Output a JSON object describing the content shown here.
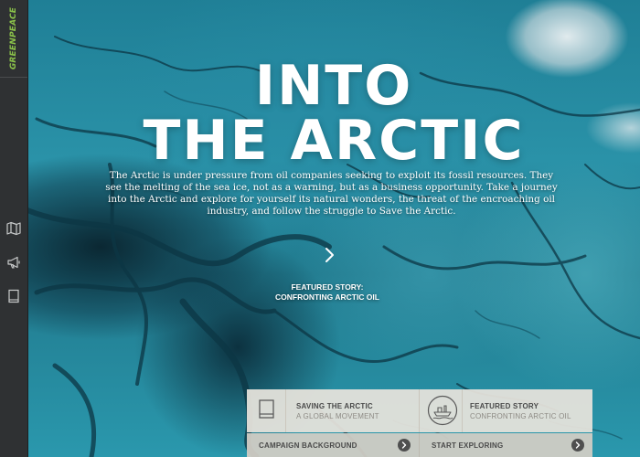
{
  "brand": {
    "logo_text": "GREENPEACE",
    "logo_color": "#8bc34a"
  },
  "sidebar": {
    "items": [
      {
        "icon": "map-icon"
      },
      {
        "icon": "megaphone-icon"
      },
      {
        "icon": "book-icon"
      }
    ]
  },
  "hero": {
    "title_line1": "INTO",
    "title_line2": "THE ARCTIC",
    "intro": "The Arctic is under pressure from oil companies seeking to exploit its fossil resources. They see the melting of the sea ice, not as a warning, but as a business opportunity. Take a journey into the Arctic and explore for yourself its natural wonders, the threat of the encroaching oil industry, and follow the struggle to Save the Arctic.",
    "next_icon": "chevron-right-icon",
    "featured_label": "FEATURED STORY:",
    "featured_title": "CONFRONTING ARCTIC OIL"
  },
  "panel": {
    "cards": [
      {
        "icon": "book-icon",
        "title": "SAVING THE ARCTIC",
        "subtitle": "A GLOBAL MOVEMENT"
      },
      {
        "icon": "ship-icon",
        "title": "FEATURED STORY",
        "subtitle": "CONFRONTING ARCTIC OIL"
      }
    ],
    "actions": [
      {
        "label": "CAMPAIGN BACKGROUND",
        "icon": "arrow-right-icon"
      },
      {
        "label": "START EXPLORING",
        "icon": "arrow-right-icon"
      }
    ]
  },
  "colors": {
    "sidebar_bg": "#2f3133",
    "panel_bg": "#e5e2db",
    "panel_bar_bg": "#d1cdc5",
    "ice_blue": "#2a92a8"
  }
}
